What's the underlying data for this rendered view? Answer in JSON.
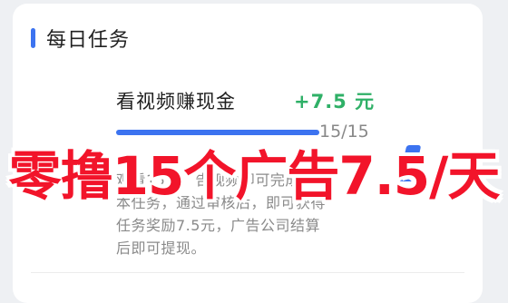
{
  "daily_tasks": {
    "section_title": "每日任务",
    "accent_color": "#3c73f0",
    "task": {
      "title": "看视频赚现金",
      "reward": "+7.5 元",
      "reward_color": "#2fb067",
      "progress_label": "15/15",
      "progress_fraction": 1.0,
      "description_lines": [
        "观看15个广告视频即可完成",
        "本任务，通过审核后，即可获得",
        "任务奖励7.5元，广告公司结算",
        "后即可提现。"
      ]
    }
  },
  "overlay_banner": {
    "text": "零撸15个广告7.5/天",
    "color": "#f2142a"
  }
}
